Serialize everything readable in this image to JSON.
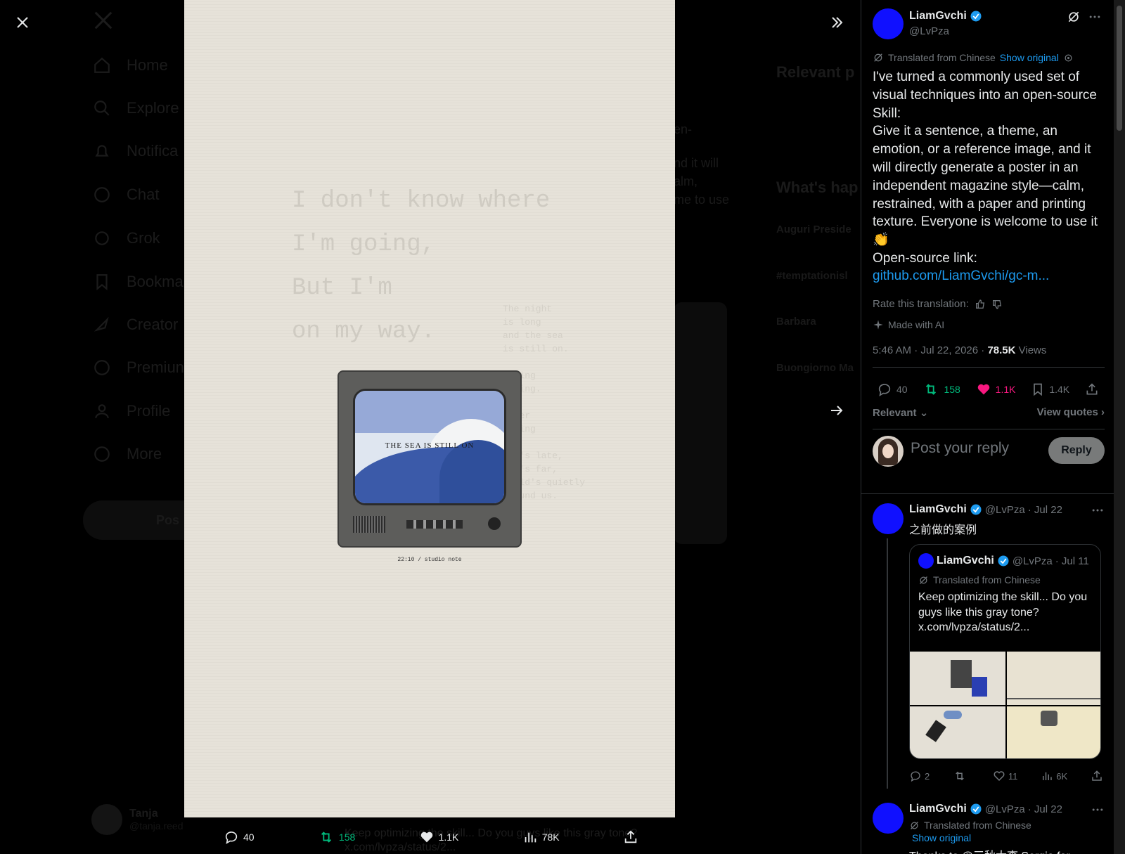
{
  "background_app": {
    "nav_items": [
      "Home",
      "Explore",
      "Notifica",
      "Chat",
      "Grok",
      "Bookma",
      "Creator",
      "Premiun",
      "Profile",
      "More"
    ],
    "post_button": "Pos",
    "profile_name": "Tanja",
    "profile_handle": "@tanja.reed",
    "right_heading_1": "Relevant p",
    "right_heading_2": "What's hap",
    "trends": [
      "Auguri Preside",
      "#temptationisl",
      "Barbara",
      "Buongiorno Ma"
    ],
    "mid_fragments": [
      "en-",
      "nd it will",
      "alm,",
      "me to use"
    ],
    "bottom_text_line1": "Keep optimizing the skill... Do you guys like this gray tone?",
    "bottom_text_line2": "x.com/lvpza/status/2..."
  },
  "media": {
    "poem_lines": [
      "I don't know where",
      "I'm going,",
      "But I'm",
      "on my way."
    ],
    "side_poem": [
      "The night",
      "is long",
      "and the sea",
      "is still on.",
      "",
      "...ing",
      "...ing.",
      "",
      "...er",
      "...ing",
      "",
      "...'s late,",
      "...'s far,",
      "...ld's quietly",
      "around us."
    ],
    "tv_caption": "THE SEA IS STILL ON",
    "caption": "22:10 / studio note"
  },
  "media_actions": {
    "replies": "40",
    "reposts": "158",
    "likes": "1.1K",
    "views": "78K"
  },
  "tweet": {
    "author_name": "LiamGvchi",
    "author_handle": "@LvPza",
    "translated_label": "Translated from Chinese",
    "show_original": "Show original",
    "text": "I've turned a commonly used set of visual techniques into an open-source Skill:\nGive it a sentence, a theme, an emotion, or a reference image, and it will directly generate a poster in an independent magazine style—calm, restrained, with a paper and printing texture. Everyone is welcome to use it 👏\nOpen-source link:",
    "link": "github.com/LiamGvchi/gc-m...",
    "rate_label": "Rate this translation:",
    "ai_label": "Made with AI",
    "timestamp": "5:46 AM · Jul 22, 2026 · ",
    "views_count": "78.5K",
    "views_label": " Views",
    "stats": {
      "replies": "40",
      "reposts": "158",
      "likes": "1.1K",
      "bookmarks": "1.4K"
    },
    "sort_label": "Relevant",
    "view_quotes": "View quotes",
    "reply_placeholder": "Post your reply",
    "reply_button": "Reply"
  },
  "replies": [
    {
      "name": "LiamGvchi",
      "handle": "@LvPza",
      "date": "· Jul 22",
      "text": "之前做的案例",
      "quote": {
        "name": "LiamGvchi",
        "handle": "@LvPza",
        "date": "· Jul 11",
        "translated_label": "Translated from Chinese",
        "text": "Keep optimizing the skill... Do you guys like this gray tone? x.com/lvpza/status/2..."
      },
      "stats": {
        "replies": "2",
        "reposts": "",
        "likes": "11",
        "views": "6K"
      }
    },
    {
      "name": "LiamGvchi",
      "handle": "@LvPza",
      "date": "· Jul 22",
      "translated_label": "Translated from Chinese",
      "show_original": "Show original",
      "text": "Thanks to @三秋大李 Sergio for"
    }
  ],
  "colors": {
    "accent_blue": "#1d9bf0",
    "repost_green": "#00ba7c",
    "like_pink": "#f91880",
    "avatar_blue": "#1010ff",
    "muted": "#71767b"
  }
}
